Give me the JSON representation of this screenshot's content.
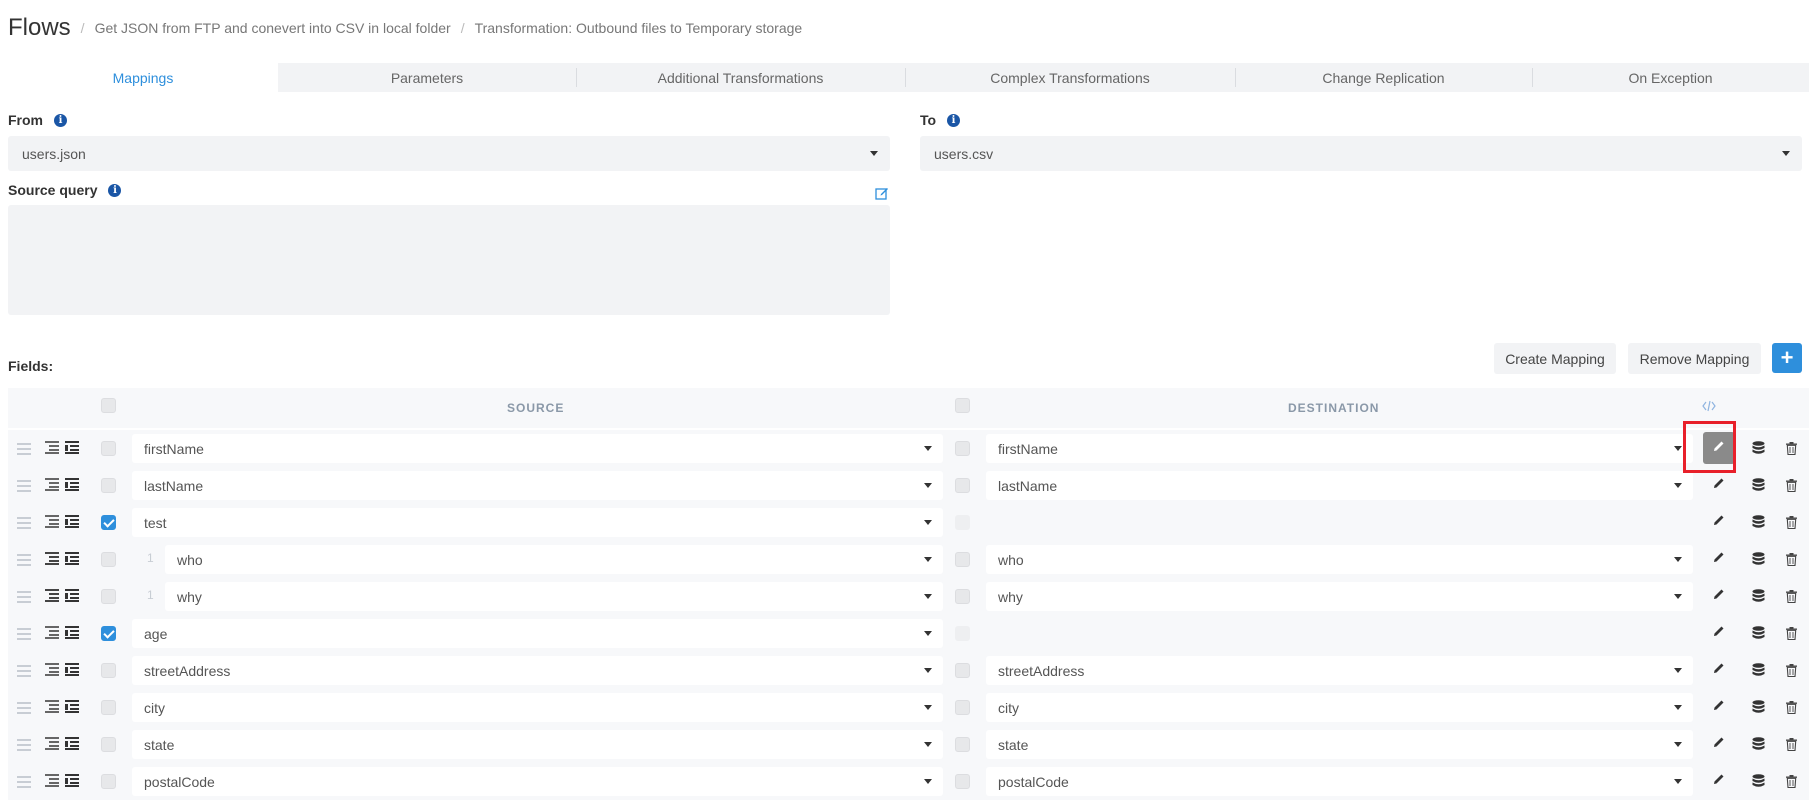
{
  "breadcrumb": {
    "title": "Flows",
    "items": [
      "Get JSON from FTP and conevert into CSV in local folder",
      "Transformation: Outbound files to Temporary storage"
    ]
  },
  "tabs": [
    {
      "label": "Mappings",
      "active": true
    },
    {
      "label": "Parameters",
      "active": false
    },
    {
      "label": "Additional Transformations",
      "active": false
    },
    {
      "label": "Complex Transformations",
      "active": false
    },
    {
      "label": "Change Replication",
      "active": false
    },
    {
      "label": "On Exception",
      "active": false
    }
  ],
  "from": {
    "label": "From",
    "value": "users.json"
  },
  "to": {
    "label": "To",
    "value": "users.csv"
  },
  "source_query": {
    "label": "Source query",
    "value": ""
  },
  "fields": {
    "label": "Fields:",
    "create_mapping": "Create Mapping",
    "remove_mapping": "Remove Mapping",
    "add": "+",
    "source_header": "SOURCE",
    "destination_header": "DESTINATION"
  },
  "rows": [
    {
      "source": "firstName",
      "destination": "firstName",
      "checked": false,
      "child": false,
      "edit_highlighted": true
    },
    {
      "source": "lastName",
      "destination": "lastName",
      "checked": false,
      "child": false
    },
    {
      "source": "test",
      "destination": "",
      "checked": true,
      "child": false
    },
    {
      "source": "who",
      "destination": "who",
      "checked": false,
      "child": true,
      "index": "1"
    },
    {
      "source": "why",
      "destination": "why",
      "checked": false,
      "child": true,
      "index": "1"
    },
    {
      "source": "age",
      "destination": "",
      "checked": true,
      "child": false
    },
    {
      "source": "streetAddress",
      "destination": "streetAddress",
      "checked": false,
      "child": false
    },
    {
      "source": "city",
      "destination": "city",
      "checked": false,
      "child": false
    },
    {
      "source": "state",
      "destination": "state",
      "checked": false,
      "child": false
    },
    {
      "source": "postalCode",
      "destination": "postalCode",
      "checked": false,
      "child": false
    }
  ],
  "colors": {
    "accent": "#2e8fdc",
    "highlight": "#e8202a",
    "panel": "#f2f3f5"
  }
}
